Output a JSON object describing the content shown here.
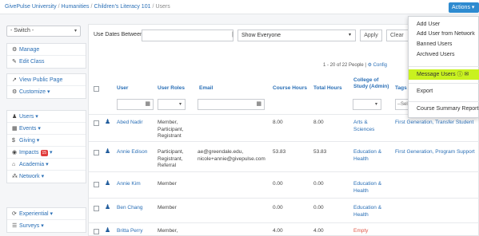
{
  "breadcrumb": [
    "GivePulse University",
    "Humanities",
    "Children's Literacy 101",
    "Users"
  ],
  "actions": {
    "label": "Actions ▾"
  },
  "sidebar": {
    "switch": "- Switch -",
    "group1": [
      {
        "icon": "⚙",
        "label": "Manage"
      },
      {
        "icon": "✎",
        "label": "Edit Class"
      }
    ],
    "group2": [
      {
        "icon": "↗",
        "label": "View Public Page"
      },
      {
        "icon": "⚙",
        "label": "Customize ▾"
      }
    ],
    "group3": [
      {
        "icon": "♟",
        "label": "Users ▾"
      },
      {
        "icon": "▦",
        "label": "Events ▾"
      },
      {
        "icon": "$",
        "label": "Giving ▾"
      },
      {
        "icon": "◉",
        "label": "Impacts",
        "badge": "15",
        "caret": "▾"
      },
      {
        "icon": "⌂",
        "label": "Academia ▾"
      },
      {
        "icon": "⁂",
        "label": "Network ▾"
      }
    ],
    "group4": [
      {
        "icon": "⟳",
        "label": "Experiential ▾"
      },
      {
        "icon": "☰",
        "label": "Surveys ▾"
      }
    ]
  },
  "filters": {
    "use_dates_label": "Use Dates Between",
    "separator": "|",
    "show_select": "Show Everyone",
    "apply": "Apply",
    "clear": "Clear"
  },
  "pagination": {
    "count": "1 - 20 of 22 People",
    "divider": "|",
    "config": "Config"
  },
  "table": {
    "headers": {
      "user": "User",
      "roles": "User Roles",
      "email": "Email",
      "course_hours": "Course Hours",
      "total_hours": "Total Hours",
      "college": "College of Study (Admin)",
      "tags": "Tags"
    },
    "tags_filter": "--Sel",
    "rows": [
      {
        "name": "Abed Nadir",
        "roles": "Member, Participant, Registrant",
        "email": "",
        "course_hours": "8.00",
        "total_hours": "8.00",
        "college": "Arts & Sciences",
        "tags": "First Generation, Transfer Student"
      },
      {
        "name": "Annie Edison",
        "roles": "Participant, Registrant, Referral",
        "email": "ae@greendale.edu, nicole+annie@givepulse.com",
        "course_hours": "53.83",
        "total_hours": "53.83",
        "college": "Education & Health",
        "tags": "First Generation, Program Support"
      },
      {
        "name": "Annie Kim",
        "roles": "Member",
        "email": "",
        "course_hours": "0.00",
        "total_hours": "0.00",
        "college": "Education & Health",
        "tags": ""
      },
      {
        "name": "Ben Chang",
        "roles": "Member",
        "email": "",
        "course_hours": "0.00",
        "total_hours": "0.00",
        "college": "Education & Health",
        "tags": ""
      },
      {
        "name": "Britta Perry",
        "roles": "Member,",
        "email": "",
        "course_hours": "4.00",
        "total_hours": "4.00",
        "college": "Empty",
        "tags": ""
      }
    ]
  },
  "dropdown": {
    "items": [
      "Add User",
      "Add User from Network",
      "Banned Users",
      "Archived Users"
    ],
    "highlighted": "Message Users",
    "highlighted_icons": "ⓘ  ✉",
    "export": "Export",
    "report": "Course Summary Report"
  },
  "colors": {
    "accent": "#2e8bd0",
    "link": "#2a6fb6",
    "highlight": "#c9f21f",
    "badge": "#e03b3b"
  }
}
